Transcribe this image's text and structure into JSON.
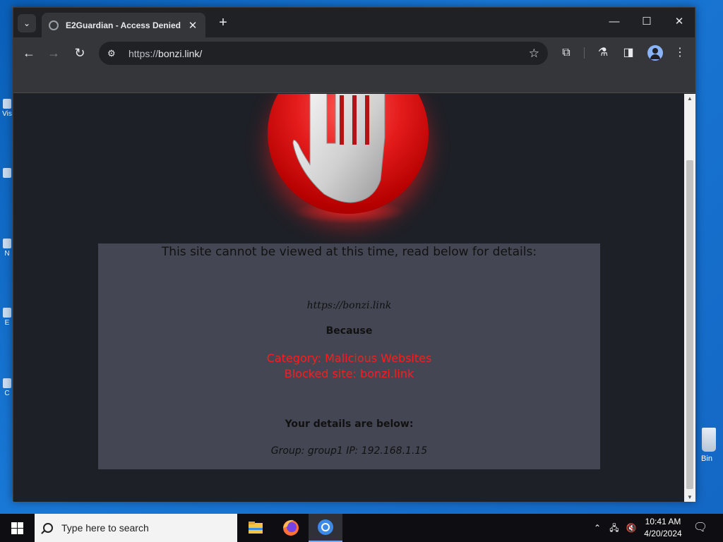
{
  "desktop": {
    "icons": [
      "Vis",
      "",
      "N",
      "E",
      "C"
    ],
    "recycle_label": "Bin"
  },
  "browser": {
    "tab": {
      "title": "E2Guardian - Access Denied",
      "close": "✕"
    },
    "new_tab": "+",
    "window_controls": {
      "minimize": "—",
      "maximize": "☐",
      "close": "✕"
    },
    "nav": {
      "back": "←",
      "forward": "→",
      "reload": "↻"
    },
    "address": {
      "scheme": "https://",
      "host": "bonzi.link/"
    },
    "toolbar_icons": [
      "extensions-icon",
      "labs-icon",
      "side-panel-icon",
      "profile-icon",
      "menu-icon"
    ]
  },
  "page": {
    "headline": "This site cannot be viewed at this time, read below for details:",
    "site": "https://bonzi.link",
    "because": "Because",
    "reason_line1": "Category: Malicious Websites",
    "reason_line2": "Blocked site: bonzi.link",
    "details_heading": "Your details are below:",
    "details": "Group: group1   IP: 192.168.1.15"
  },
  "taskbar": {
    "search_placeholder": "Type here to search",
    "apps": [
      "file-explorer-icon",
      "firefox-icon",
      "chrome-icon"
    ],
    "time": "10:41 AM",
    "date": "4/20/2024"
  },
  "colors": {
    "accent_red": "#ff1b1b",
    "panel_bg": "#444753",
    "page_bg": "#1e2027"
  }
}
